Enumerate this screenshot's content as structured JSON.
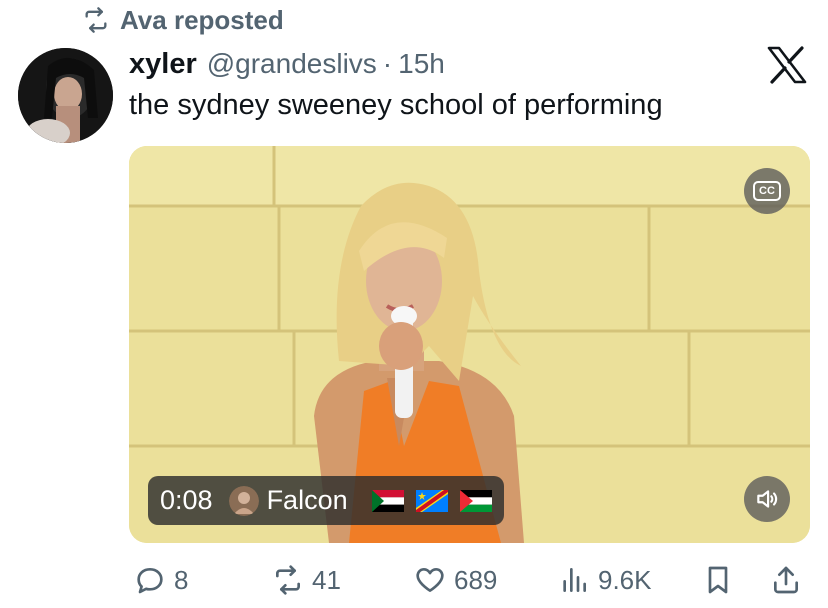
{
  "repost": {
    "icon": "repost-icon",
    "label": "Ava reposted"
  },
  "author": {
    "name": "xyler",
    "handle": "@grandeslivs",
    "separator": "·",
    "time": "15h"
  },
  "tweet": {
    "text": "the sydney sweeney school of performing"
  },
  "video": {
    "timestamp": "0:08",
    "creator": "Falcon",
    "flags": [
      "sudan-flag",
      "congo-flag",
      "palestine-flag"
    ],
    "captions_label": "CC"
  },
  "actions": {
    "replies": "8",
    "reposts": "41",
    "likes": "689",
    "views": "9.6K"
  },
  "colors": {
    "text": "#0f1419",
    "secondary": "#536471",
    "background": "#ffffff"
  }
}
